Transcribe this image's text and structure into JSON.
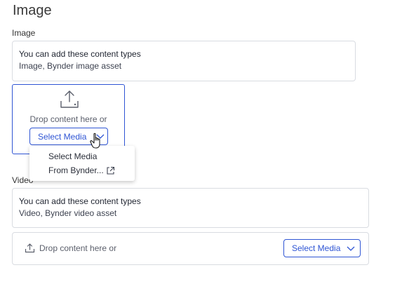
{
  "section": {
    "title": "Image"
  },
  "image_field": {
    "label": "Image",
    "info_title": "You can add these content types",
    "info_types": "Image, Bynder image asset",
    "drop_text": "Drop content here or",
    "select_label": "Select Media",
    "menu": [
      {
        "label": "Select Media"
      },
      {
        "label": "From Bynder...",
        "icon": "external-link-icon"
      }
    ]
  },
  "video_field": {
    "label": "Video",
    "info_title": "You can add these content types",
    "info_types": "Video, Bynder video asset",
    "drop_text": "Drop content here or",
    "select_label": "Select Media"
  },
  "colors": {
    "accent": "#2f55d4",
    "border": "#d9dce1"
  }
}
